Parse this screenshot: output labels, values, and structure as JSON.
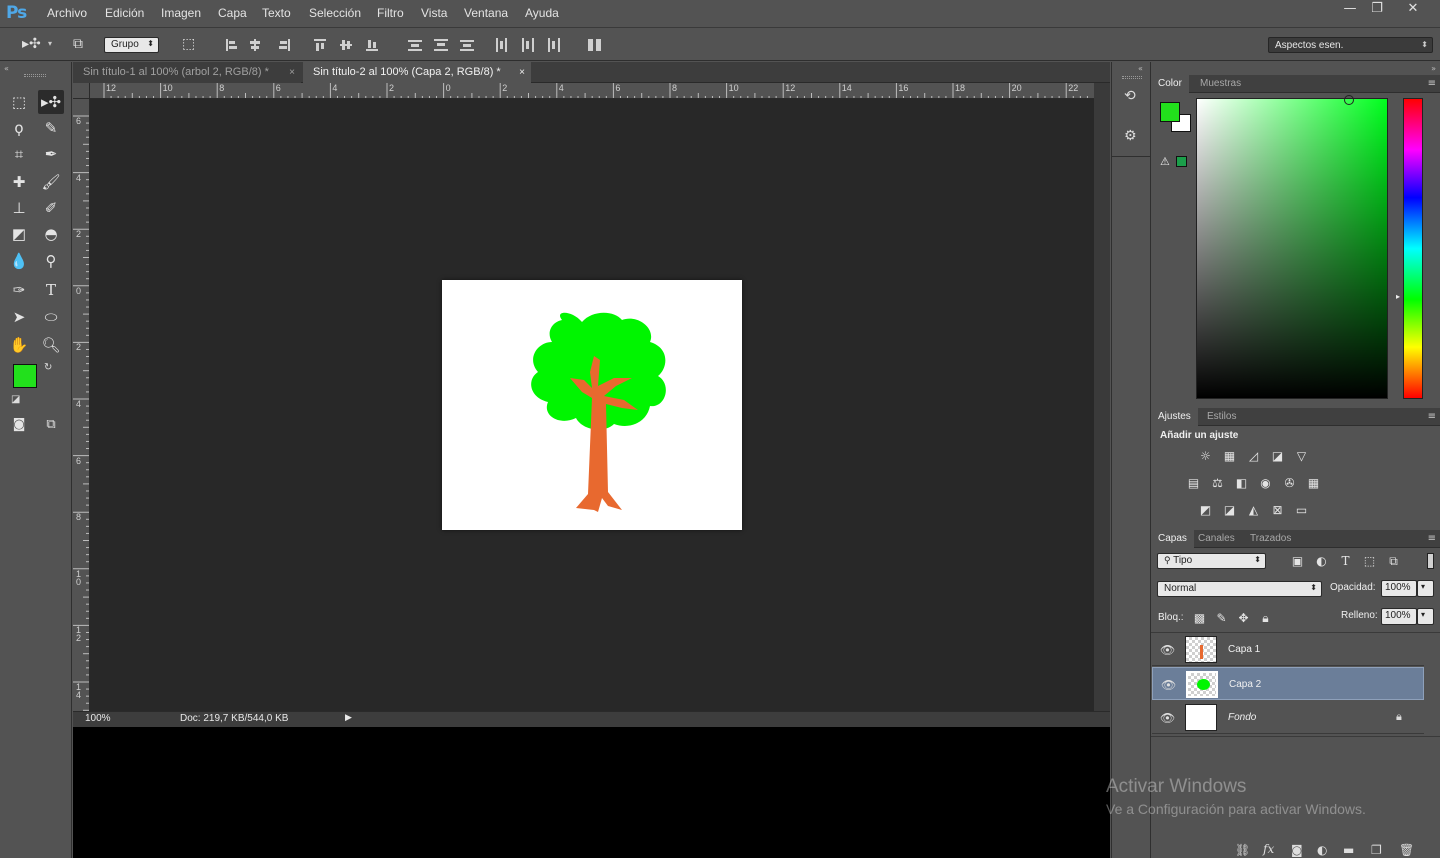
{
  "app": {
    "logo": "Ps"
  },
  "menu": [
    "Archivo",
    "Edición",
    "Imagen",
    "Capa",
    "Texto",
    "Selección",
    "Filtro",
    "Vista",
    "Ventana",
    "Ayuda"
  ],
  "window_controls": {
    "minimize": "—",
    "restore": "❐",
    "close": "✕"
  },
  "options_bar": {
    "auto_select": "Grupo",
    "workspace": "Aspectos esen."
  },
  "tabs": [
    {
      "label": "Sin título-1 al 100% (arbol 2, RGB/8) *",
      "close": "×"
    },
    {
      "label": "Sin título-2 al 100% (Capa 2, RGB/8) *",
      "close": "×"
    }
  ],
  "ruler_top": [
    "12",
    "10",
    "8",
    "6",
    "4",
    "2",
    "0",
    "2",
    "4",
    "6",
    "8",
    "10",
    "12",
    "14",
    "16",
    "18",
    "20",
    "22"
  ],
  "ruler_left": [
    "6",
    "4",
    "2",
    "0",
    "2",
    "4",
    "6",
    "8",
    "10",
    "12",
    "14"
  ],
  "status": {
    "zoom": "100%",
    "doc": "Doc: 219,7 KB/544,0 KB"
  },
  "colors": {
    "foreground": "#22e01c",
    "background": "#ffffff",
    "tree_green": "#00f500",
    "trunk": "#e8692f",
    "selected_layer": "#6b7e99"
  },
  "color_panel": {
    "tabs": [
      "Color",
      "Muestras"
    ]
  },
  "adjustments_panel": {
    "tabs": [
      "Ajustes",
      "Estilos"
    ],
    "heading": "Añadir un ajuste"
  },
  "layers_panel": {
    "tabs": [
      "Capas",
      "Canales",
      "Trazados"
    ],
    "filter": "Tipo",
    "blend_mode": "Normal",
    "opacity_label": "Opacidad:",
    "opacity": "100%",
    "lock_label": "Bloq.:",
    "fill_label": "Relleno:",
    "fill": "100%",
    "layers": [
      {
        "name": "Capa 1"
      },
      {
        "name": "Capa 2"
      },
      {
        "name": "Fondo"
      }
    ]
  },
  "watermark": {
    "line1": "Activar Windows",
    "line2": "Ve a Configuración para activar Windows."
  }
}
